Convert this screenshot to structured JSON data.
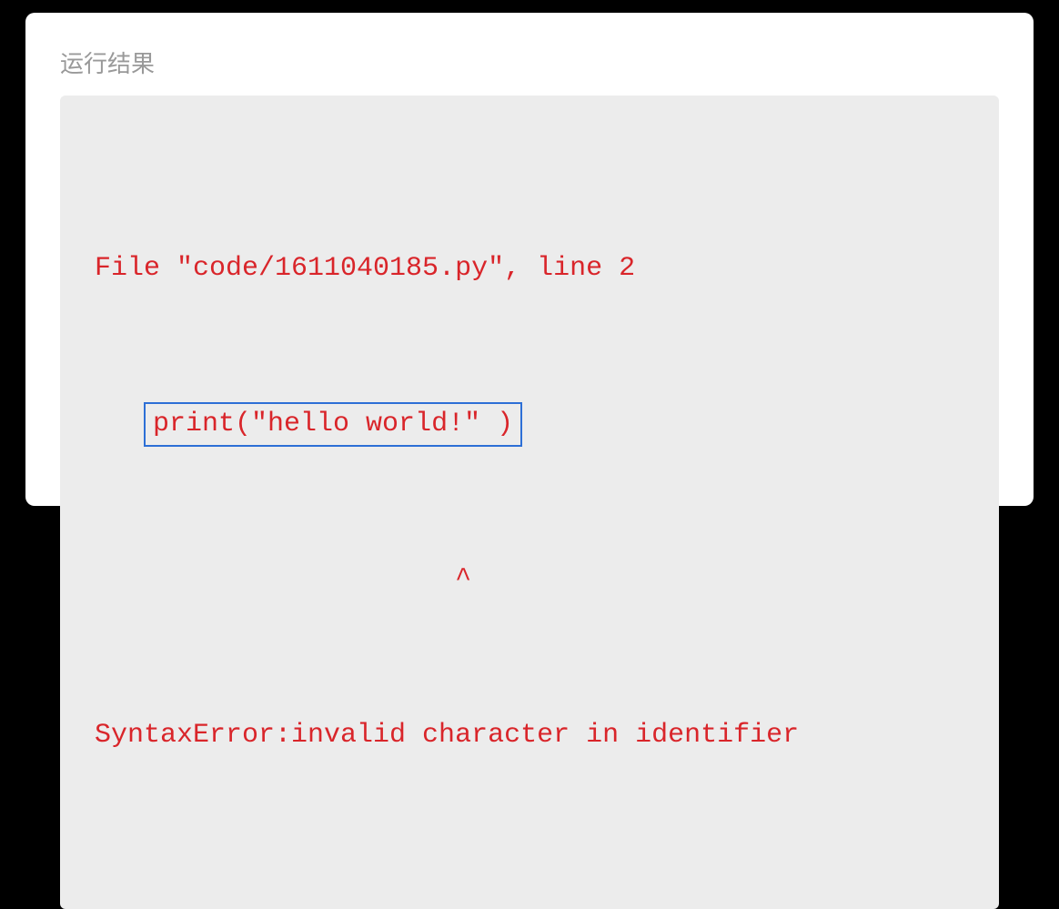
{
  "section": {
    "title": "运行结果"
  },
  "output": {
    "line1": "File \"code/1611040185.py\", line 2",
    "indent": "   ",
    "highlighted_code": "print(\"hello world!\" )",
    "caret_line": "                      ^",
    "error_message": "SyntaxError:invalid character in identifier"
  }
}
